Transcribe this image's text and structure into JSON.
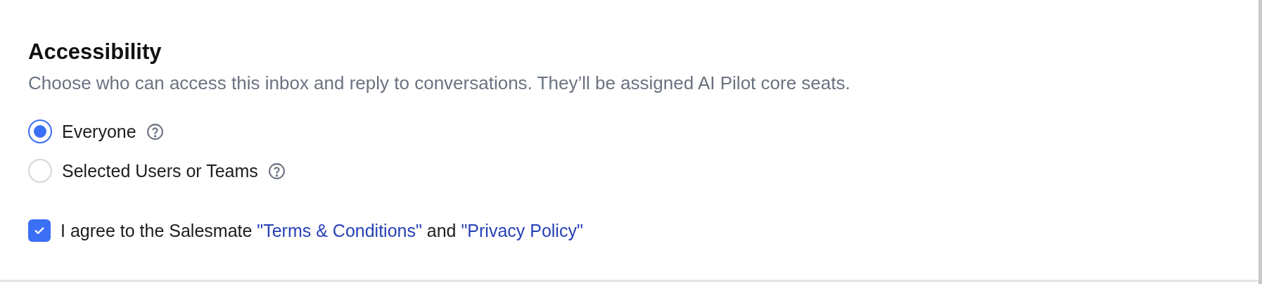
{
  "section": {
    "title": "Accessibility",
    "description": "Choose who can access this inbox and reply to conversations. They’ll be assigned AI Pilot core seats."
  },
  "options": [
    {
      "label": "Everyone",
      "selected": true
    },
    {
      "label": "Selected Users or Teams",
      "selected": false
    }
  ],
  "agreement": {
    "checked": true,
    "prefix": "I agree to the Salesmate ",
    "links": [
      "\"Terms & Conditions\"",
      "\"Privacy Policy\""
    ],
    "joiner": " and "
  }
}
